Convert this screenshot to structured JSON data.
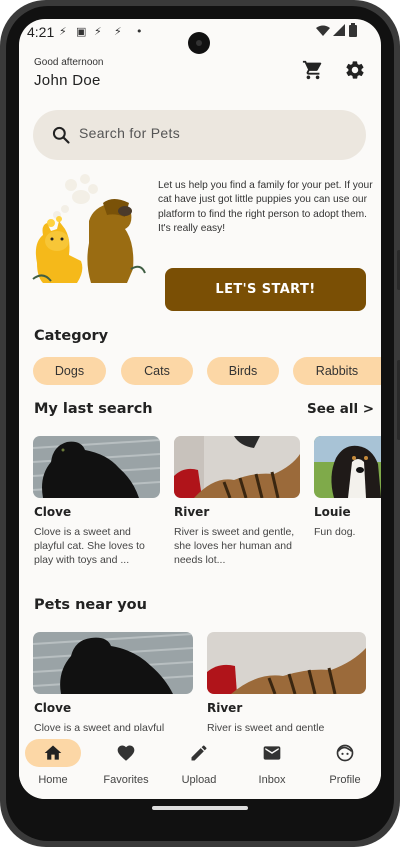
{
  "status_bar": {
    "time": "4:21"
  },
  "header": {
    "greeting": "Good afternoon",
    "user_name": "John Doe"
  },
  "search": {
    "placeholder": "Search for Pets"
  },
  "hero": {
    "text": "Let us help you find a family for your pet. If your cat have just got little puppies you can use our platform to find the right person to adopt them. It's really easy!",
    "button_label": "LET'S START!"
  },
  "category": {
    "title": "Category",
    "chips": [
      "Dogs",
      "Cats",
      "Birds",
      "Rabbits"
    ]
  },
  "last_search": {
    "title": "My last search",
    "see_all": "See all >",
    "items": [
      {
        "name": "Clove",
        "desc": "Clove is a sweet and playful cat. She loves to play with toys and ..."
      },
      {
        "name": "River",
        "desc": "River is sweet and gentle, she loves her human and needs lot..."
      },
      {
        "name": "Louie",
        "desc": "Fun dog."
      }
    ]
  },
  "near_you": {
    "title": "Pets near you",
    "items": [
      {
        "name": "Clove",
        "desc": "Clove is a sweet and playful"
      },
      {
        "name": "River",
        "desc": "River is sweet and gentle"
      }
    ]
  },
  "nav": {
    "items": [
      {
        "label": "Home",
        "icon": "home-icon",
        "active": true
      },
      {
        "label": "Favorites",
        "icon": "heart-icon",
        "active": false
      },
      {
        "label": "Upload",
        "icon": "pencil-icon",
        "active": false
      },
      {
        "label": "Inbox",
        "icon": "mail-icon",
        "active": false
      },
      {
        "label": "Profile",
        "icon": "face-icon",
        "active": false
      }
    ]
  },
  "colors": {
    "accent_brown": "#7a4f05",
    "chip_bg": "#fcd7a6",
    "search_bg": "#ece7df"
  }
}
